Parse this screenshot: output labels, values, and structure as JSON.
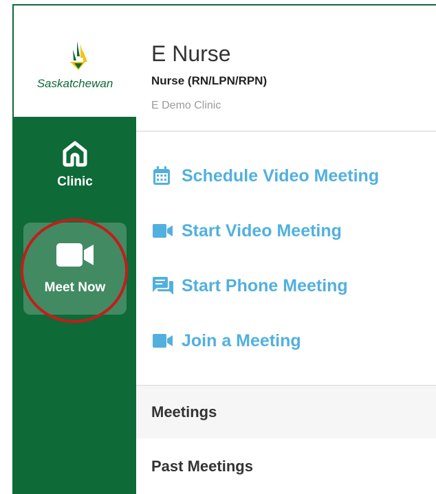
{
  "brand": {
    "logo_text": "Saskatchewan",
    "primary_color": "#0e6a37",
    "accent_color": "#52b0de",
    "highlight_color": "#c61b1b"
  },
  "sidebar": {
    "items": [
      {
        "label": "Clinic",
        "icon": "home-icon",
        "active": false
      },
      {
        "label": "Meet Now",
        "icon": "video-camera-icon",
        "active": true
      }
    ]
  },
  "header": {
    "user_name": "E Nurse",
    "user_role": "Nurse (RN/LPN/RPN)",
    "clinic_name": "E Demo Clinic"
  },
  "actions": [
    {
      "label": "Schedule Video Meeting",
      "icon": "calendar-icon"
    },
    {
      "label": "Start Video Meeting",
      "icon": "video-camera-icon"
    },
    {
      "label": "Start Phone Meeting",
      "icon": "chat-icon"
    },
    {
      "label": "Join a Meeting",
      "icon": "video-camera-icon"
    }
  ],
  "sections": [
    {
      "label": "Meetings"
    },
    {
      "label": "Past Meetings"
    }
  ]
}
